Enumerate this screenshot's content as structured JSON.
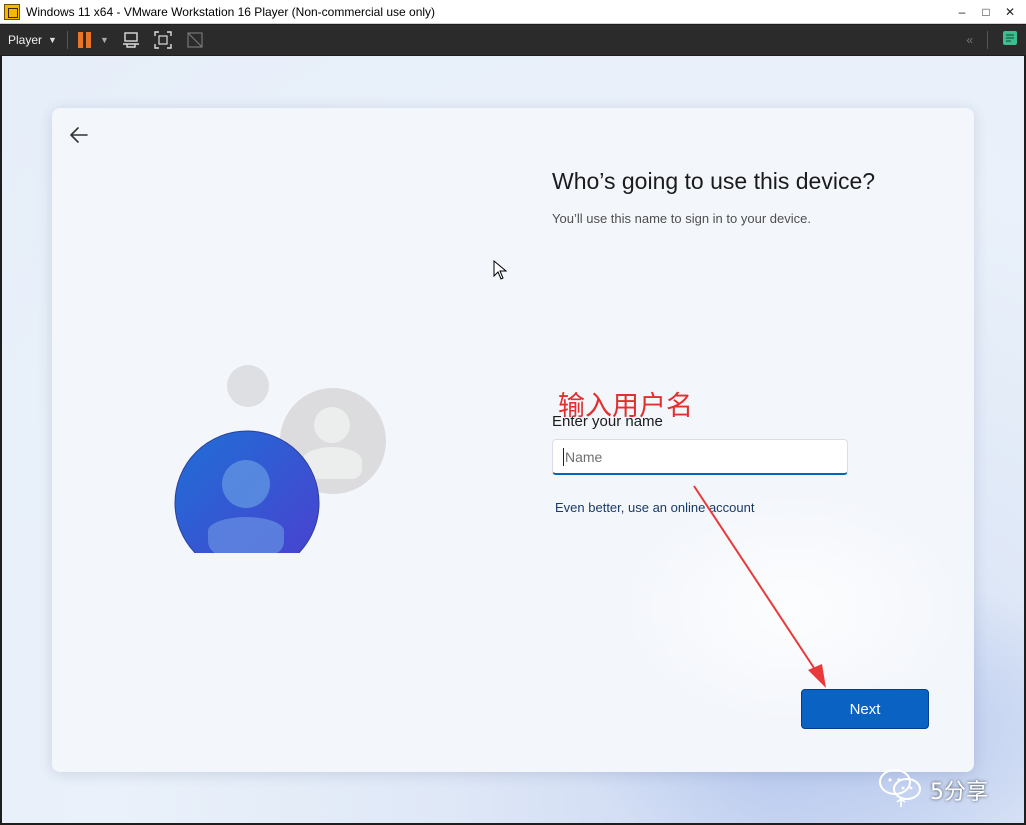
{
  "window": {
    "title": "Windows 11 x64 - VMware Workstation 16 Player (Non-commercial use only)",
    "minimize": "–",
    "maximize": "□",
    "close": "✕"
  },
  "toolbar": {
    "player_label": "Player",
    "icons": [
      "pause-icon",
      "send-ctrl-alt-del-icon",
      "fullscreen-icon",
      "unity-icon",
      "collapse-icon",
      "notes-icon"
    ],
    "accent": "#e8742a"
  },
  "oobe": {
    "heading": "Who’s going to use this device?",
    "subheading": "You’ll use this name to sign in to your device.",
    "name_label": "Enter your name",
    "name_placeholder": "Name",
    "name_value": "",
    "online_link": "Even better, use an online account",
    "next_label": "Next",
    "accent": "#0a63c2"
  },
  "annotation": {
    "text": "输入用户名",
    "color": "#e03030"
  },
  "watermark": {
    "text": "5分享"
  }
}
